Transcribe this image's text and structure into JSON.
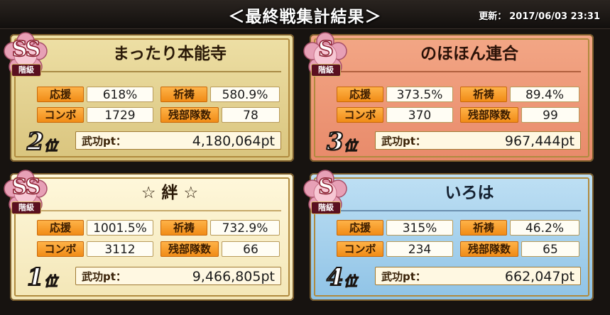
{
  "header": {
    "title": "＜最終戦集計結果＞",
    "updated_label": "更新：",
    "updated_value": "2017/06/03 23:31"
  },
  "colors": {
    "label_orange": "#f5a030",
    "panel_gold": "#e7d595",
    "panel_cream": "#fbf0cb",
    "panel_salmon": "#ec9474",
    "panel_blue": "#9ccbea",
    "badge_pink": "#e7a0b6"
  },
  "labels": {
    "support": "応援",
    "prayer": "祈祷",
    "combo": "コンボ",
    "remaining": "残部隊数",
    "points": "武功pt："
  },
  "teams": [
    {
      "name": "まったり本能寺",
      "tier": "SS",
      "tier_label": "階級",
      "rank_num": "2",
      "rank_suffix": "位",
      "support": "618%",
      "prayer": "580.9%",
      "combo": "1729",
      "remaining": "78",
      "points": "4,180,064pt"
    },
    {
      "name": "のほほん連合",
      "tier": "S",
      "tier_label": "階級",
      "rank_num": "3",
      "rank_suffix": "位",
      "support": "373.5%",
      "prayer": "89.4%",
      "combo": "370",
      "remaining": "99",
      "points": "967,444pt"
    },
    {
      "name": "☆ 絆 ☆",
      "tier": "SS",
      "tier_label": "階級",
      "rank_num": "1",
      "rank_suffix": "位",
      "support": "1001.5%",
      "prayer": "732.9%",
      "combo": "3112",
      "remaining": "66",
      "points": "9,466,805pt"
    },
    {
      "name": "いろは",
      "tier": "S",
      "tier_label": "階級",
      "rank_num": "4",
      "rank_suffix": "位",
      "support": "315%",
      "prayer": "46.2%",
      "combo": "234",
      "remaining": "65",
      "points": "662,047pt"
    }
  ]
}
